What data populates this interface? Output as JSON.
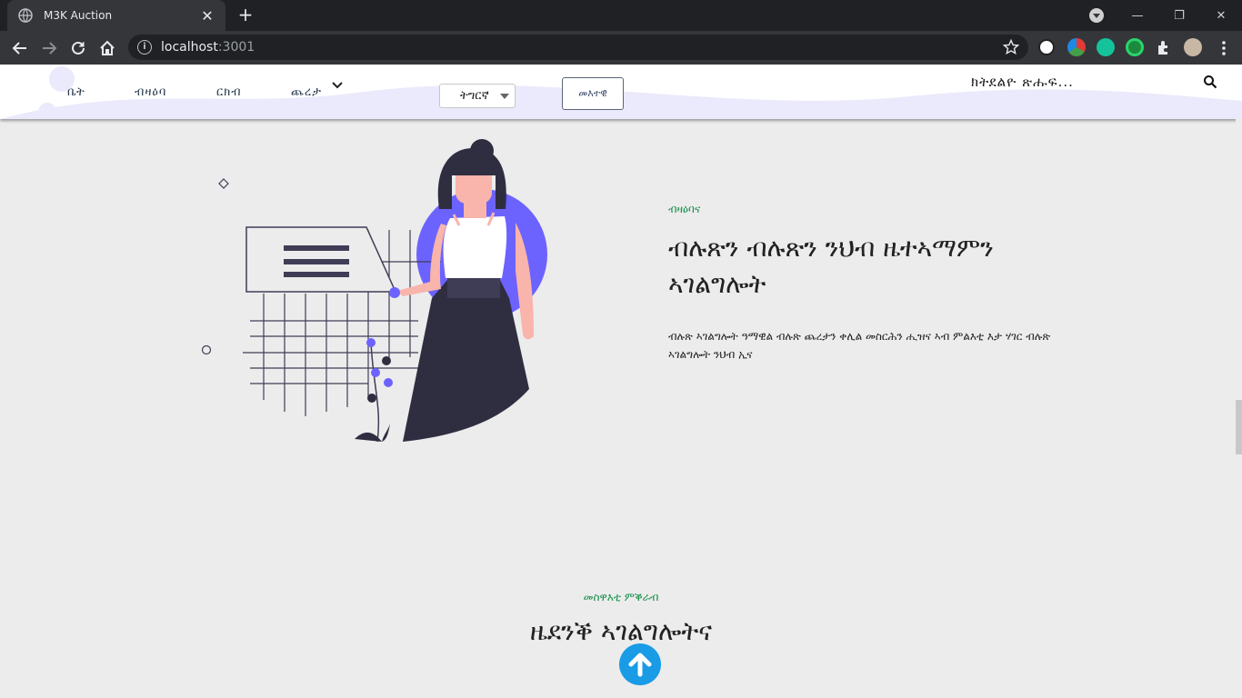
{
  "browser": {
    "tab_title": "M3K Auction",
    "url_host": "localhost",
    "url_port": ":3001"
  },
  "nav": {
    "home": "ቤት",
    "auctions": "ብዛዕባ",
    "contact": "ርክብ",
    "categories": "ጨረታ",
    "language": "ትግርኛ",
    "login": "መእተዊ",
    "search_placeholder": "ክትደልዮ ጽሑፍ..."
  },
  "hero": {
    "eyebrow": "ብዛዕባና",
    "title": "ብሉጽን ብሉጽን ንህብ ዜተኣማምን ኣገልግሎት",
    "description": "ብሉጽ ኣገልግሎት ዓማዊል ብሉጽ ጨረታን ቀሊል መስርሕን ሒዝና ኣብ ምልእቲ እታ ሃገር ብሉጽ ኣገልግሎት ንህብ ኢና"
  },
  "section": {
    "eyebrow": "መስዋእቲ ምቕራብ",
    "title": "ዜደንቕ ኣገልግሎትና"
  },
  "colors": {
    "accent_green": "#17904a",
    "illustration_purple": "#6c63ff",
    "illustration_dark": "#2f2e41",
    "scroll_top_blue": "#1a9be6"
  },
  "icons": [
    "globe-icon",
    "close-icon",
    "plus-icon",
    "back-icon",
    "forward-icon",
    "reload-icon",
    "home-icon",
    "info-icon",
    "star-icon",
    "extension-icon",
    "search-icon",
    "chevron-down-icon",
    "arrow-up-icon"
  ]
}
